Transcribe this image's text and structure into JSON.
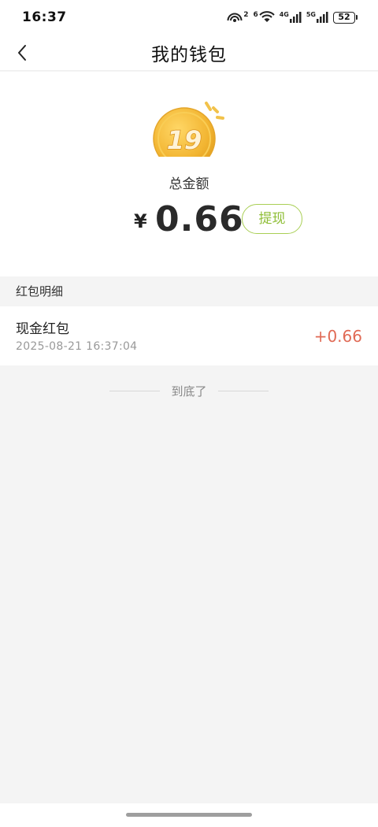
{
  "status_bar": {
    "time": "16:37",
    "hotspot_label": "2",
    "wifi_label": "6",
    "signal_1_label": "4G",
    "signal_2_label": "5G",
    "battery": "52"
  },
  "header": {
    "title": "我的钱包",
    "back_icon": "chevron-left-icon"
  },
  "wallet": {
    "coin_icon": "coin-19-icon",
    "coin_label": "19",
    "total_label": "总金额",
    "currency": "¥",
    "amount": "0.66",
    "withdraw_label": "提现"
  },
  "records": {
    "section_title": "红包明细",
    "items": [
      {
        "title": "现金红包",
        "time": "2025-08-21 16:37:04",
        "amount": "+0.66"
      }
    ],
    "end_text": "到底了"
  },
  "colors": {
    "accent_green": "#8fbe37",
    "amount_red": "#e06a55",
    "coin_gold": "#f2b532"
  }
}
